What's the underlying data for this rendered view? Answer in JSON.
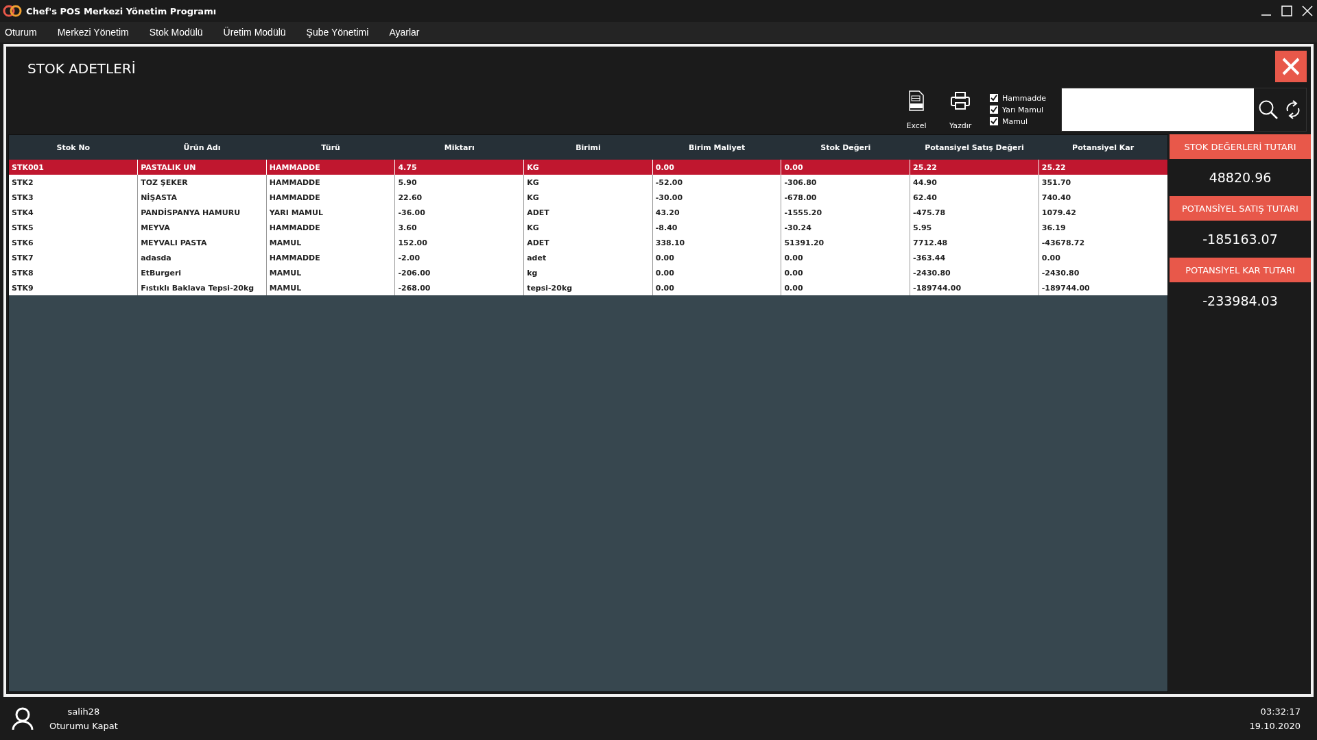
{
  "window": {
    "title": "Chef's POS Merkezi Yönetim Programı"
  },
  "menu": [
    "Oturum",
    "Merkezi Yönetim",
    "Stok Modülü",
    "Üretim Modülü",
    "Şube Yönetimi",
    "Ayarlar"
  ],
  "page": {
    "title": "STOK ADETLERİ"
  },
  "toolbar": {
    "buttons": [
      {
        "kind": "excel",
        "label": "Excel"
      },
      {
        "kind": "print",
        "label": "Yazdır"
      }
    ],
    "filters": [
      {
        "label": "Hammadde",
        "checked": true
      },
      {
        "label": "Yarı Mamul",
        "checked": true
      },
      {
        "label": "Mamul",
        "checked": true
      }
    ]
  },
  "table": {
    "columns": [
      "Stok No",
      "Ürün Adı",
      "Türü",
      "Miktarı",
      "Birimi",
      "Birim Maliyet",
      "Stok Değeri",
      "Potansiyel Satış Değeri",
      "Potansiyel Kar"
    ],
    "rows": [
      {
        "selected": true,
        "cells": [
          "STK001",
          "PASTALIK UN",
          "HAMMADDE",
          "4.75",
          "KG",
          "0.00",
          "0.00",
          "25.22",
          "25.22"
        ]
      },
      {
        "selected": false,
        "cells": [
          "STK2",
          "TOZ ŞEKER",
          "HAMMADDE",
          "5.90",
          "KG",
          "-52.00",
          "-306.80",
          "44.90",
          "351.70"
        ]
      },
      {
        "selected": false,
        "cells": [
          "STK3",
          "NİŞASTA",
          "HAMMADDE",
          "22.60",
          "KG",
          "-30.00",
          "-678.00",
          "62.40",
          "740.40"
        ]
      },
      {
        "selected": false,
        "cells": [
          "STK4",
          "PANDİSPANYA HAMURU",
          "YARI MAMUL",
          "-36.00",
          "ADET",
          "43.20",
          "-1555.20",
          "-475.78",
          "1079.42"
        ]
      },
      {
        "selected": false,
        "cells": [
          "STK5",
          "MEYVA",
          "HAMMADDE",
          "3.60",
          "KG",
          "-8.40",
          "-30.24",
          "5.95",
          "36.19"
        ]
      },
      {
        "selected": false,
        "cells": [
          "STK6",
          "MEYVALI PASTA",
          "MAMUL",
          "152.00",
          "ADET",
          "338.10",
          "51391.20",
          "7712.48",
          "-43678.72"
        ]
      },
      {
        "selected": false,
        "cells": [
          "STK7",
          "adasda",
          "HAMMADDE",
          "-2.00",
          "adet",
          "0.00",
          "0.00",
          "-363.44",
          "0.00"
        ]
      },
      {
        "selected": false,
        "cells": [
          "STK8",
          "EtBurgeri",
          "MAMUL",
          "-206.00",
          "kg",
          "0.00",
          "0.00",
          "-2430.80",
          "-2430.80"
        ]
      },
      {
        "selected": false,
        "cells": [
          "STK9",
          "Fıstıklı Baklava Tepsi-20kg",
          "MAMUL",
          "-268.00",
          "tepsi-20kg",
          "0.00",
          "0.00",
          "-189744.00",
          "-189744.00"
        ]
      }
    ]
  },
  "summary": [
    {
      "label": "STOK DEĞERLERİ TUTARI",
      "value": "48820.96"
    },
    {
      "label": "POTANSİYEL SATIŞ TUTARI",
      "value": "-185163.07"
    },
    {
      "label": "POTANSİYEL KAR TUTARI",
      "value": "-233984.03"
    }
  ],
  "footer": {
    "user": "salih28",
    "logout": "Oturumu Kapat",
    "time": "03:32:17",
    "date": "19.10.2020"
  }
}
